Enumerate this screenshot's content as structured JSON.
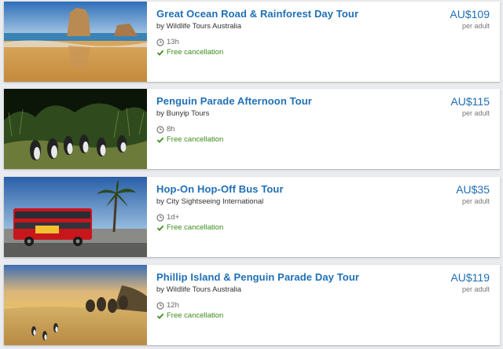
{
  "tours": [
    {
      "title": "Great Ocean Road & Rainforest Day Tour",
      "vendor": "by Wildlife Tours Australia",
      "duration": "13h",
      "cancellation": "Free cancellation",
      "price": "AU$109",
      "price_unit": "per adult",
      "image": "coastal-rock-stacks-beach-photo"
    },
    {
      "title": "Penguin Parade Afternoon Tour",
      "vendor": "by Bunyip Tours",
      "duration": "8h",
      "cancellation": "Free cancellation",
      "price": "AU$115",
      "price_unit": "per adult",
      "image": "little-penguins-in-grass-photo"
    },
    {
      "title": "Hop-On Hop-Off Bus Tour",
      "vendor": "by City Sightseeing International",
      "duration": "1d+",
      "cancellation": "Free cancellation",
      "price": "AU$35",
      "price_unit": "per adult",
      "image": "red-double-decker-bus-photo"
    },
    {
      "title": "Phillip Island & Penguin Parade Day Tour",
      "vendor": "by Wildlife Tours Australia",
      "duration": "12h",
      "cancellation": "Free cancellation",
      "price": "AU$119",
      "price_unit": "per adult",
      "image": "group-watching-penguins-at-sunset-photo"
    }
  ],
  "colors": {
    "title": "#1f6fb5",
    "price": "#1f6fb5",
    "cancellation": "#3d8c1d",
    "background": "#e9ebee"
  },
  "icons": {
    "duration": "clock-icon",
    "cancellation": "checkmark-icon"
  }
}
